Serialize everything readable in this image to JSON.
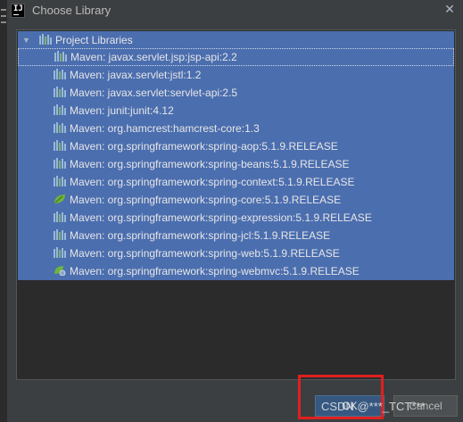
{
  "window": {
    "title": "Choose Library",
    "app_icon_text": "IJ",
    "close_glyph": "✕"
  },
  "tree": {
    "root": {
      "label": "Project Libraries",
      "expanded": true,
      "icon": "library-icon"
    },
    "items": [
      {
        "label": "Maven: javax.servlet.jsp:jsp-api:2.2",
        "icon": "library-icon"
      },
      {
        "label": "Maven: javax.servlet:jstl:1.2",
        "icon": "library-icon"
      },
      {
        "label": "Maven: javax.servlet:servlet-api:2.5",
        "icon": "library-icon"
      },
      {
        "label": "Maven: junit:junit:4.12",
        "icon": "library-icon"
      },
      {
        "label": "Maven: org.hamcrest:hamcrest-core:1.3",
        "icon": "library-icon"
      },
      {
        "label": "Maven: org.springframework:spring-aop:5.1.9.RELEASE",
        "icon": "library-icon"
      },
      {
        "label": "Maven: org.springframework:spring-beans:5.1.9.RELEASE",
        "icon": "library-icon"
      },
      {
        "label": "Maven: org.springframework:spring-context:5.1.9.RELEASE",
        "icon": "library-icon"
      },
      {
        "label": "Maven: org.springframework:spring-core:5.1.9.RELEASE",
        "icon": "spring-leaf-icon"
      },
      {
        "label": "Maven: org.springframework:spring-expression:5.1.9.RELEASE",
        "icon": "library-icon"
      },
      {
        "label": "Maven: org.springframework:spring-jcl:5.1.9.RELEASE",
        "icon": "library-icon"
      },
      {
        "label": "Maven: org.springframework:spring-web:5.1.9.RELEASE",
        "icon": "library-icon"
      },
      {
        "label": "Maven: org.springframework:spring-webmvc:5.1.9.RELEASE",
        "icon": "spring-web-icon"
      }
    ]
  },
  "buttons": {
    "ok_label": "OK",
    "cancel_label": "Cancel"
  },
  "watermark": "CSDN @***_TCT***",
  "colors": {
    "selection": "#4b6eaf",
    "background": "#3c3f41",
    "tree_background": "#2b2b2b",
    "highlight_box": "#e0201f",
    "ok_button": "#365880"
  }
}
